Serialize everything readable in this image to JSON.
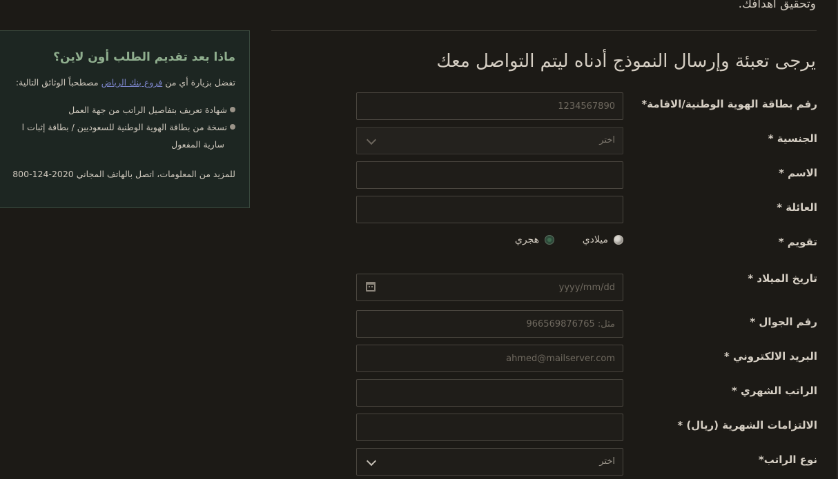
{
  "intro_tail": "وتحقيق أهدافك.",
  "form_title": "يرجى تعبئة وإرسال النموذج أدناه ليتم التواصل معك",
  "info_panel": {
    "title": "ماذا بعد تقديم الطلب أون لاين؟",
    "intro_prefix": "تفضل بزيارة أي من",
    "intro_link": "فروع بنك الرياض",
    "intro_suffix": "مصطحباً الوثائق التالية:",
    "items": [
      {
        "text": "شهادة تعريف بتفاصيل الراتب من جهة العمل",
        "cont": ""
      },
      {
        "text": "نسخة من بطاقة الهوية الوطنية للسعوديين / بطاقة إثبات ا",
        "cont": "سارية المفعول"
      }
    ],
    "footer": "للمزيد من المعلومات، اتصل بالهاتف المجاني 2020-124-800"
  },
  "form": {
    "id_label": "رقم بطاقة الهوية الوطنية/الاقامة*",
    "id_placeholder": "1234567890",
    "nationality_label": "الجنسية *",
    "nationality_value": "اختر",
    "name_label": "الاسم *",
    "family_label": "العائلة *",
    "calendar_label": "تقويم *",
    "calendar_options": [
      "ميلادي",
      "هجري"
    ],
    "dob_label": "تاريخ الميلاد *",
    "dob_placeholder": "yyyy/mm/dd",
    "mobile_label": "رقم الجوال *",
    "mobile_placeholder": "مثل: 966569876765",
    "email_label": "البريد الالكتروني *",
    "email_placeholder": "ahmed@mailserver.com",
    "salary_label": "الراتب الشهري *",
    "obligations_label": "الالتزامات الشهرية (ريال) *",
    "salary_type_label": "نوع الراتب*",
    "salary_type_value": "اختر"
  },
  "icons": {
    "select_arrow": "chevron-down-icon",
    "date_picker": "calendar-icon",
    "list_bullet": "bullet-icon"
  },
  "colors": {
    "background": "#1c1a16",
    "panel_background": "#1d2622",
    "panel_title": "#8fae8e",
    "link": "#7b84c9"
  }
}
